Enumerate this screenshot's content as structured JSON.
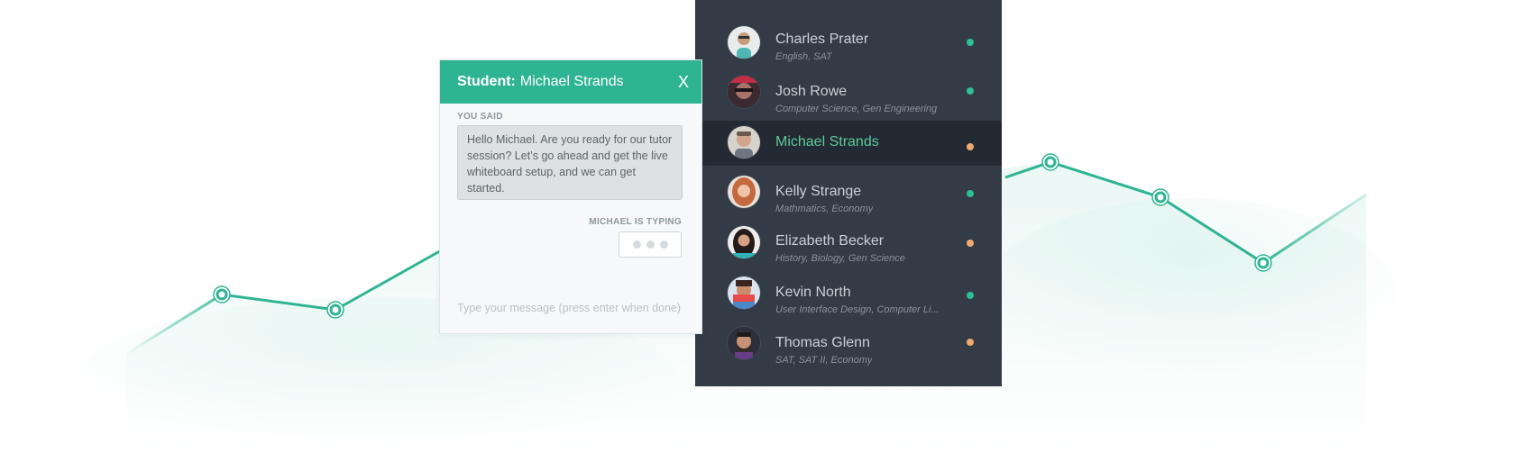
{
  "colors": {
    "accent": "#2fb493",
    "online": "#2fbf94",
    "away": "#f0a96f",
    "panel_bg": "#333b47",
    "panel_selected_bg": "#232a33",
    "selected_name": "#5fc99b"
  },
  "chat": {
    "title_prefix": "Student:",
    "title_name": "Michael Strands",
    "close_label": "X",
    "you_said_label": "YOU SAID",
    "message": "Hello Michael. Are you ready for our tutor session? Let’s go ahead and get the live whiteboard setup, and we can get started.",
    "typing_label": "MICHAEL IS TYPING",
    "input_placeholder": "Type your message (press enter when done)",
    "input_value": ""
  },
  "students": [
    {
      "name": "Charles Prater",
      "subjects": "English, SAT",
      "status": "online",
      "selected": false,
      "avatar": "avatar-charles"
    },
    {
      "name": "Josh Rowe",
      "subjects": "Computer Science, Gen Engineering",
      "status": "online",
      "selected": false,
      "avatar": "avatar-josh"
    },
    {
      "name": "Michael Strands",
      "subjects": "",
      "status": "away",
      "selected": true,
      "avatar": "avatar-michael"
    },
    {
      "name": "Kelly Strange",
      "subjects": "Mathmatics, Economy",
      "status": "online",
      "selected": false,
      "avatar": "avatar-kelly"
    },
    {
      "name": "Elizabeth Becker",
      "subjects": "History, Biology, Gen Science",
      "status": "away",
      "selected": false,
      "avatar": "avatar-elizabeth"
    },
    {
      "name": "Kevin North",
      "subjects": "User Interface Design, Computer Li...",
      "status": "online",
      "selected": false,
      "avatar": "avatar-kevin"
    },
    {
      "name": "Thomas Glenn",
      "subjects": "SAT, SAT II, Economy",
      "status": "away",
      "selected": false,
      "avatar": "avatar-thomas"
    }
  ]
}
